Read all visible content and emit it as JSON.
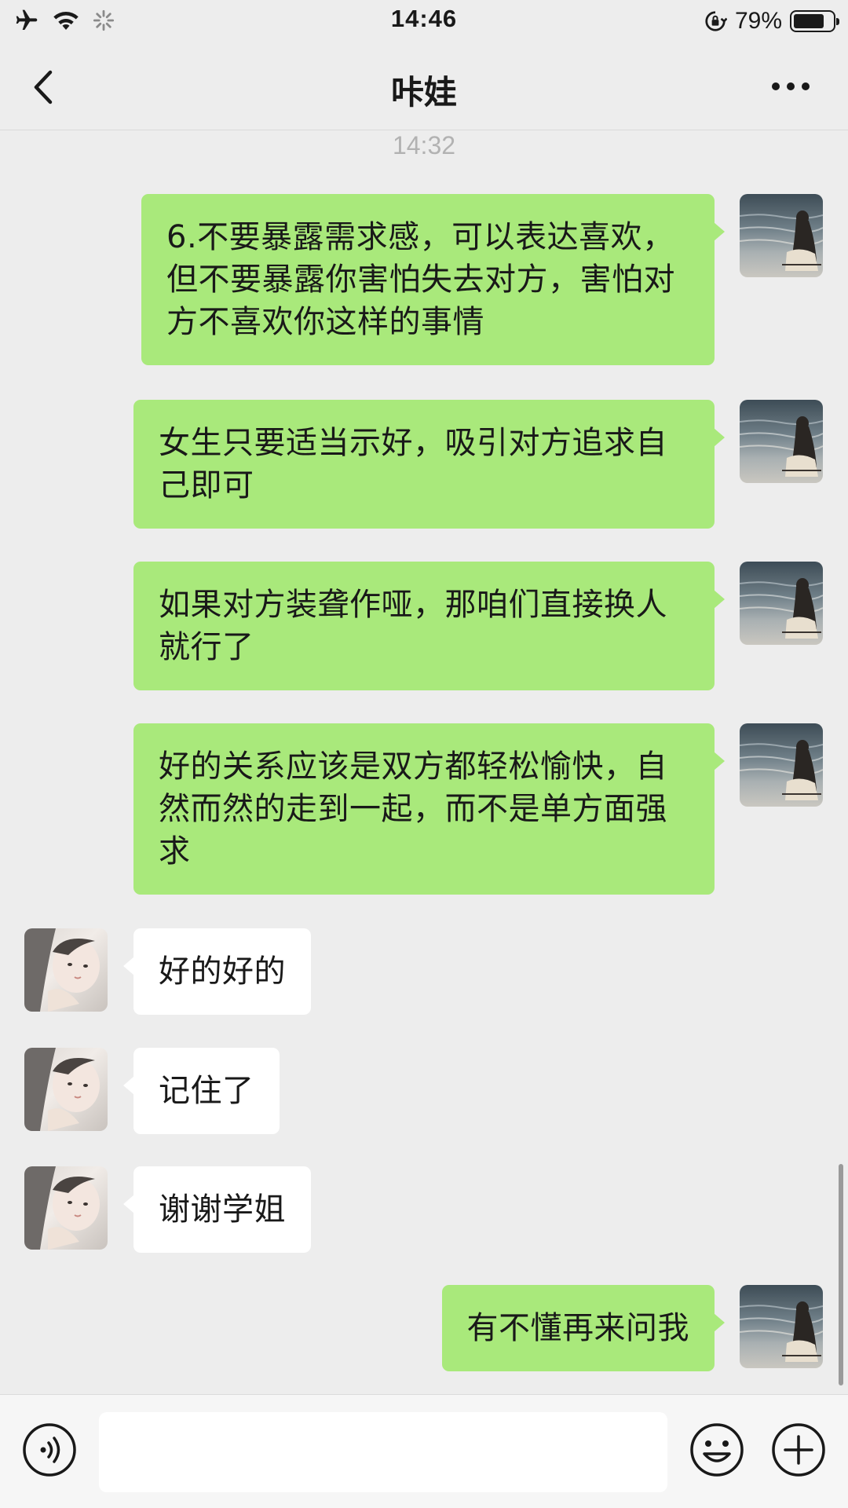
{
  "status_bar": {
    "time": "14:46",
    "battery_percent": "79%",
    "battery_level": 0.79,
    "icons": [
      "airplane-icon",
      "wifi-icon",
      "loading-icon",
      "orientation-lock-icon",
      "battery-icon"
    ]
  },
  "header": {
    "title": "咔娃",
    "back_icon": "chevron-left-icon",
    "more_icon": "more-dots-icon"
  },
  "chat": {
    "timestamp": "14:32",
    "messages": [
      {
        "sender": "me",
        "text": "6.不要暴露需求感，可以表达喜欢，但不要暴露你害怕失去对方，害怕对方不喜欢你这样的事情"
      },
      {
        "sender": "me",
        "text": "女生只要适当示好，吸引对方追求自己即可"
      },
      {
        "sender": "me",
        "text": "如果对方装聋作哑，那咱们直接换人就行了"
      },
      {
        "sender": "me",
        "text": "好的关系应该是双方都轻松愉快，自然而然的走到一起，而不是单方面强求"
      },
      {
        "sender": "other",
        "text": "好的好的"
      },
      {
        "sender": "other",
        "text": "记住了"
      },
      {
        "sender": "other",
        "text": "谢谢学姐"
      },
      {
        "sender": "me",
        "text": "有不懂再来问我"
      }
    ]
  },
  "input_bar": {
    "value": "",
    "icons": [
      "voice-icon",
      "emoji-icon",
      "plus-icon"
    ]
  },
  "colors": {
    "background": "#ededed",
    "my_bubble": "#a9e97b",
    "other_bubble": "#ffffff"
  }
}
